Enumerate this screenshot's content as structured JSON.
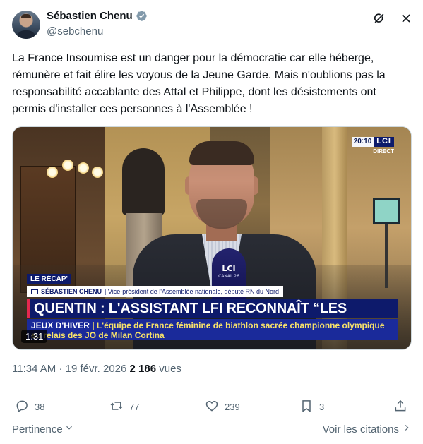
{
  "author": {
    "name": "Sébastien Chenu",
    "handle": "@sebchenu",
    "verified_color": "#829aab"
  },
  "tweet": {
    "text": "La France Insoumise est un danger pour la démocratie car elle héberge, rémunère et fait élire les voyous de la Jeune Garde. Mais n'oublions pas la responsabilité accablante des Attal et Philippe, dont les désistements ont permis d'installer ces personnes à l'Assemblée !"
  },
  "media": {
    "channel_time": "20:10",
    "channel_logo": "LCI",
    "live_label": "DIRECT",
    "mic_logo": "LCI",
    "mic_sub": "CANAL 26",
    "recap_label": "LE RÉCAP'",
    "guest_name": "SÉBASTIEN CHENU",
    "guest_title": "| Vice-président de l'Assemblée nationale, député RN du Nord",
    "headline": "QUENTIN : L'ASSISTANT LFI RECONNAÎT “LES VIOLENCES”",
    "ticker_label": "JEUX D'HIVER",
    "ticker_text": "| L'équipe de France féminine de biathlon sacrée championne olympique au relais des JO de Milan Cortina",
    "duration": "1:31"
  },
  "meta": {
    "time": "11:34 AM",
    "separator": "·",
    "date": "19 févr. 2026",
    "views_count": "2 186",
    "views_label": "vues"
  },
  "actions": {
    "replies": "38",
    "reposts": "77",
    "likes": "239",
    "bookmarks": "3"
  },
  "footer": {
    "relevance": "Pertinence",
    "quotes": "Voir les citations"
  },
  "icons": [
    "grok-icon",
    "close-icon",
    "reply-icon",
    "repost-icon",
    "like-icon",
    "bookmark-icon",
    "share-icon",
    "chevron-down-icon",
    "chevron-right-icon",
    "verified-icon",
    "camera-icon"
  ]
}
